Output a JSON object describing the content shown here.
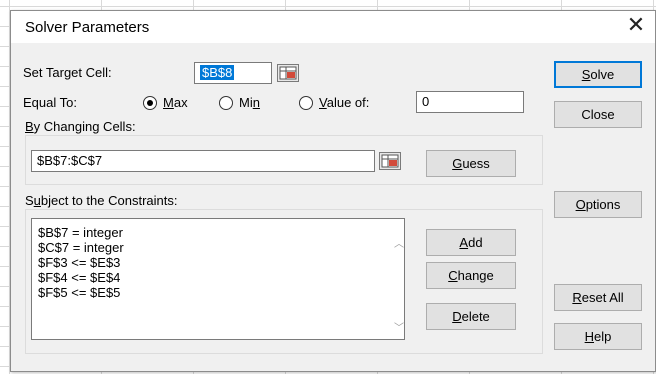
{
  "window": {
    "title": "Solver Parameters",
    "close_glyph": "✕"
  },
  "target": {
    "label_pre": "Set Target Cell:",
    "value": "$B$8"
  },
  "equal_to": {
    "label": "Equal To:",
    "max": {
      "u": "M",
      "rest": "ax",
      "checked": true
    },
    "min": {
      "pre": "Mi",
      "u": "n",
      "checked": false
    },
    "value_of": {
      "u": "V",
      "rest": "alue of:",
      "checked": false
    },
    "value_field": "0"
  },
  "changing": {
    "u": "B",
    "rest": "y Changing Cells:",
    "value": "$B$7:$C$7"
  },
  "constraints": {
    "pre": "S",
    "u": "u",
    "rest": "bject to the Constraints:",
    "items": [
      "$B$7 = integer",
      "$C$7 = integer",
      "$F$3 <= $E$3",
      "$F$4 <= $E$4",
      "$F$5 <= $E$5"
    ]
  },
  "buttons": {
    "solve": {
      "u": "S",
      "rest": "olve"
    },
    "close": "Close",
    "guess": {
      "u": "G",
      "rest": "uess"
    },
    "options": {
      "u": "O",
      "rest": "ptions"
    },
    "add": {
      "u": "A",
      "rest": "dd"
    },
    "change": {
      "u": "C",
      "rest": "hange"
    },
    "delete": {
      "u": "D",
      "rest": "elete"
    },
    "reset_all": {
      "u": "R",
      "rest": "eset All"
    },
    "help": {
      "u": "H",
      "rest": "elp"
    }
  },
  "icons": {
    "picker": "range-picker-icon",
    "scroll_up": "up-arrow-icon",
    "scroll_down": "down-arrow-icon"
  },
  "colors": {
    "accent": "#0078d7",
    "dialog_bg": "#f0f0f0"
  }
}
